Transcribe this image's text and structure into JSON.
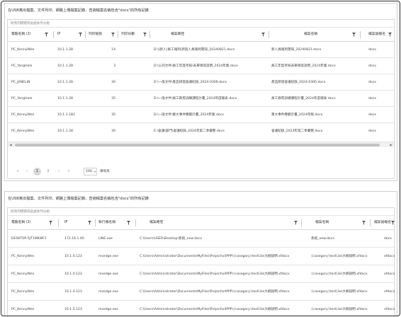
{
  "panel1": {
    "title": "在USB寫出檔案、文件列印、網路上傳檔案記錄，查詢檔案名稱包含\"docx\"的所有記錄",
    "group_hint": "拖曳列標題到此處依列分組",
    "columns": [
      "電腦名稱 (2)",
      "IP",
      "列印紙張",
      "列印份數",
      "檔案路徑",
      "檔案名稱",
      "檔案副檔名"
    ],
    "rows": [
      [
        "PC_KennyWen",
        "10.1.1.28",
        "14",
        "",
        "D:\\(新人)員工報到\\新進人員報到需知_20240821.docx",
        "新人員報到需知_20240821.docx",
        "docx"
      ],
      [
        "PC_YangHole",
        "10.1.1.28",
        "3",
        "",
        "D:\\公司文件\\員工年度考核\\表單填寫說明_2024年版.docx",
        "員工年度考核表單填寫說明_2024年版.docx",
        "docx"
      ],
      [
        "PC_JANELIN",
        "10.1.1.28",
        "30",
        "",
        "D:\\一般文件\\產品研發會議紀錄_2024-0306.docx",
        "產品研發會議紀錄_2024-0306.docx",
        "docx"
      ],
      [
        "PC_YangHole",
        "10.1.1.28",
        "35",
        "",
        "D:\\一般文件\\員工教育訓練課程計畫_2024年度總表.docx",
        "員工教育訓練課程計畫_2024年度總表.docx",
        "docx"
      ],
      [
        "PC_KennyWen",
        "10.1.1.183",
        "35",
        "",
        "D:\\一般文件\\重大事件應變計畫_2024年版.docx",
        "重大事件應變計畫_2024年版.docx",
        "docx"
      ],
      [
        "PC_KennyWen",
        "10.1.1.28",
        "30",
        "",
        "E:\\會議\\部門\\會議紀錄_2024年第二季彙整.docx",
        "會議紀錄_2024年第二季彙整.docx",
        "docx"
      ]
    ],
    "pager": {
      "first": "«",
      "prev": "‹",
      "pages": [
        "1",
        "2"
      ],
      "next": "›",
      "last": "»",
      "page_size": "100",
      "page_size_label": "筆每頁"
    }
  },
  "panel2": {
    "title": "在USB寫出檔案、文件列印、網路上傳檔案記錄，查詢檔案名稱包含\"docx\"的所有記錄",
    "group_hint": "拖曳列標題到此處依列分組",
    "columns": [
      "電腦名稱 (2)",
      "IP",
      "執行檔名稱",
      "檔案路徑",
      "檔案名稱",
      "檔案副檔名"
    ],
    "rows": [
      [
        "DESKTOP-5JT1MKWF1",
        "172.16.1.46",
        "LINE.exe",
        "C:\\Users\\USER\\Desktop\\系統_new.docx",
        "系統_new.docx",
        "docx"
      ],
      [
        "PC_KennyWen",
        "10.1.0.123",
        "msedge.exe",
        "C:\\Users\\Administrator\\Documents\\MyFiles\\Project\\s4PPP\\{casegory}test\\3a\\大綱說明.xfdocx",
        "{casegory}test\\3a\\大綱說明.xfdocx",
        "xfdocx"
      ],
      [
        "PC_KennyWen",
        "10.1.0.123",
        "msedge.exe",
        "C:\\Users\\Administrator\\Documents\\MyFiles\\Project\\s4PPP\\{casegory}test\\3a\\大綱說明.xfdocx",
        "{casegory}test\\3a\\大綱說明.xfdocx",
        "xfdocx"
      ],
      [
        "PC_KennyWen",
        "10.1.0.123",
        "msedge.exe",
        "C:\\Users\\Administrator\\Documents\\MyFiles\\Project\\s4PPP\\{casegory}test\\3a\\大綱說明.xfdocx",
        "{casegory}test\\3a\\大綱說明.xfdocx",
        "xfdocx"
      ],
      [
        "PC_KennyWen",
        "10.1.0.123",
        "msedge.exe",
        "C:\\Users\\Administrator\\Documents\\MyFiles\\Project\\s4PPP\\{casegory}test\\3a\\大綱說明.xfdocx",
        "{casegory}test\\3a\\大綱說明.xfdocx",
        "xfdocx"
      ]
    ]
  },
  "icons": {
    "filter": "filter-icon",
    "scroll_left": "arrow-left-icon",
    "scroll_right": "arrow-right-icon"
  },
  "colors": {
    "border": "#cfcfcf",
    "active_page": "#d9d9d9",
    "frame": "#2b2b2b"
  }
}
